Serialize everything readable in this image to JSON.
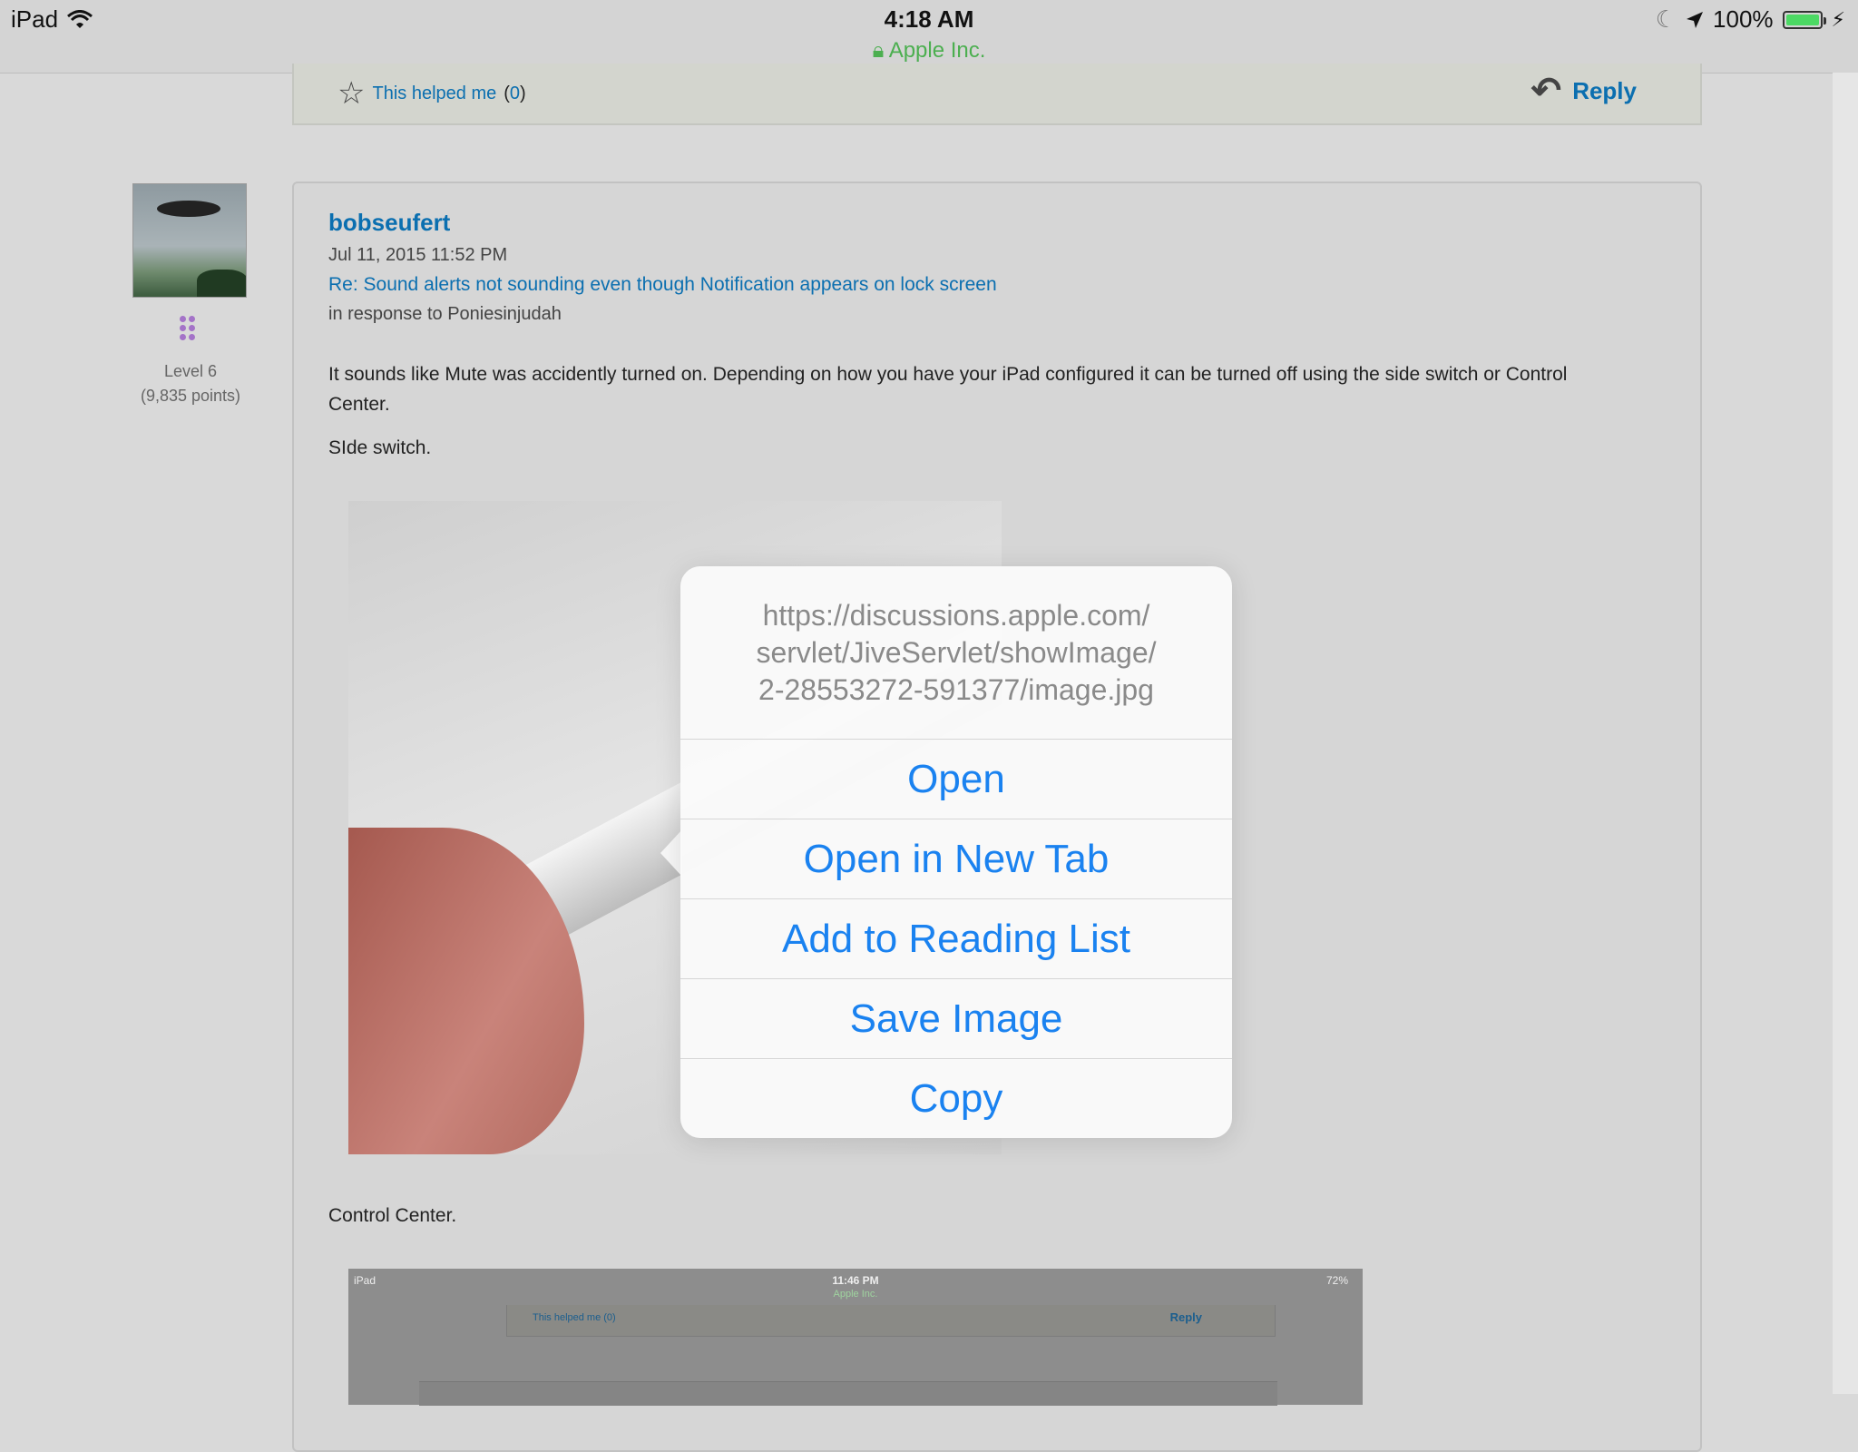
{
  "status_bar": {
    "device": "iPad",
    "time": "4:18 AM",
    "site": "Apple Inc.",
    "battery": "100%",
    "icons": [
      "wifi-icon",
      "moon-icon",
      "location-arrow-icon",
      "battery-icon",
      "charging-icon",
      "lock-icon"
    ]
  },
  "prev_post": {
    "helped_label": "This helped me",
    "helped_count": "0",
    "reply_label": "Reply"
  },
  "post": {
    "author": "bobseufert",
    "level": "Level 6",
    "points": "(9,835 points)",
    "date": "Jul 11, 2015 11:52 PM",
    "subject": "Re: Sound alerts not sounding even though Notification appears on lock screen",
    "in_response": "in response to Poniesinjudah",
    "body": "It sounds like Mute was accidently turned on. Depending on how you have your iPad configured it can be turned off using the side switch or Control Center.",
    "side_switch": "SIde switch.",
    "control_center": "Control Center.",
    "embedded_screenshot": {
      "device": "iPad",
      "time": "11:46 PM",
      "site": "Apple Inc.",
      "battery": "72%",
      "helped": "This helped me (0)",
      "reply": "Reply"
    }
  },
  "popover": {
    "url": "https://discussions.apple.com/servlet/JiveServlet/showImage/2-28553272-591377/image.jpg",
    "url_lines": [
      "https://discussions.apple.com/",
      "servlet/JiveServlet/showImage/",
      "2-28553272-591377/image.jpg"
    ],
    "items": [
      "Open",
      "Open in New Tab",
      "Add to Reading List",
      "Save Image",
      "Copy"
    ],
    "accent_color": "#1a82f0"
  }
}
